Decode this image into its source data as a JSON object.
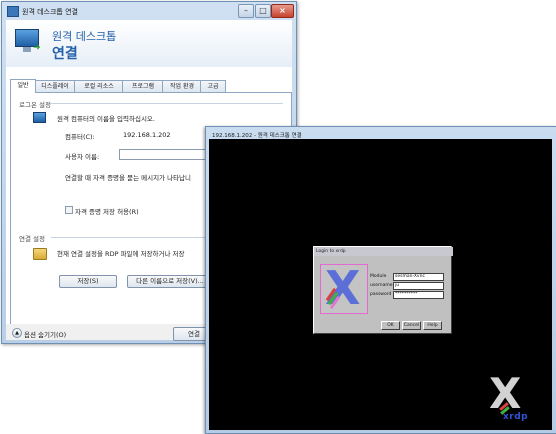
{
  "rdp_window": {
    "title": "원격 데스크톱 연결",
    "banner_line1": "원격 데스크톱",
    "banner_line2": "연결",
    "tabs": [
      {
        "label": "일반"
      },
      {
        "label": "디스플레이"
      },
      {
        "label": "로컬 리소스"
      },
      {
        "label": "프로그램"
      },
      {
        "label": "작업 환경"
      },
      {
        "label": "고급"
      }
    ],
    "logon": {
      "group_title": "로그온 설정",
      "instruction": "원격 컴퓨터의 이름을 입력하십시오.",
      "computer_label": "컴퓨터(C):",
      "computer_value": "192.168.1.202",
      "username_label": "사용자 이름:",
      "username_value": "",
      "note": "연결할 때 자격 증명을 묻는 메시지가 나타납니",
      "save_credentials_label": "자격 증명 저장 허용(R)"
    },
    "connection": {
      "group_title": "연결 설정",
      "description": "현재 연결 설정을 RDP 파일에 저장하거나 저장",
      "save_button": "저장(S)",
      "save_as_button": "다른 이름으로 저장(V)..."
    },
    "footer": {
      "options_label": "옵션 숨기기(O)",
      "connect_button": "연결"
    }
  },
  "session_window": {
    "title": "192.168.1.202 - 원격 데스크톱 연결",
    "login_dialog": {
      "title": "Login to xrdp",
      "module_label": "Module",
      "module_value": "sesman-Xvnc",
      "username_label": "username",
      "username_value": "ju",
      "password_label": "password",
      "password_value": "**********",
      "ok_button": "OK",
      "cancel_button": "Cancel",
      "help_button": "Help"
    },
    "logo_word": "xrdp"
  },
  "colors": {
    "accent": "#2260a8",
    "session_background": "#000000",
    "login_dialog_gray": "#c0c0c0",
    "xrdp_blue": "#2f55d6",
    "logo_border": "#e26ad0"
  }
}
